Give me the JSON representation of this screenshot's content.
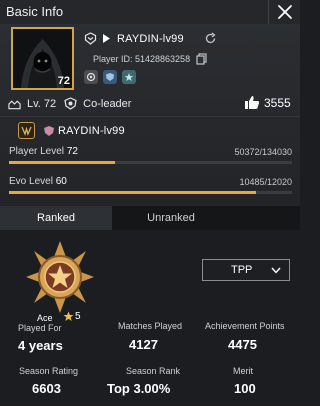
{
  "window": {
    "title": "Basic Info"
  },
  "profile": {
    "avatar_level": "72",
    "player_name": "RAYDIN-lv99",
    "player_id_label": "Player ID: 51428863258",
    "level_label": "Lv. 72",
    "role": "Co-leader",
    "likes": "3555",
    "clan_name": "RAYDIN-lv99"
  },
  "progress": {
    "player_level": {
      "label": "Player Level",
      "value": "72",
      "xp": "50372/134030",
      "fraction": 0.376
    },
    "evo_level": {
      "label": "Evo Level",
      "value": "60",
      "xp": "10485/12020",
      "fraction": 0.872
    }
  },
  "tabs": [
    {
      "label": "Ranked",
      "active": true
    },
    {
      "label": "Unranked",
      "active": false
    }
  ],
  "ranked": {
    "mode_select": "TPP",
    "tier": "Ace",
    "stars": "5",
    "stats": {
      "played_for": {
        "label": "Played For",
        "value": "4 years"
      },
      "matches_played": {
        "label": "Matches Played",
        "value": "4127"
      },
      "achievement_points": {
        "label": "Achievement Points",
        "value": "4475"
      },
      "season_rating": {
        "label": "Season Rating",
        "value": "6603"
      },
      "season_rank": {
        "label": "Season Rank",
        "value": "Top 3.00%"
      },
      "merit": {
        "label": "Merit",
        "value": "100"
      }
    }
  },
  "colors": {
    "accent_gold": "#e8a93a",
    "avatar_border": "#d3a54a",
    "background": "#1b1d20"
  },
  "icons": {
    "close": "close-icon",
    "rank_small": "rank-chevron-icon",
    "refresh": "refresh-icon",
    "copy": "copy-icon",
    "level": "level-icon",
    "role": "co-leader-icon",
    "likes": "thumbs-up-icon",
    "clan": "clan-emblem-icon",
    "tier_badge": "ace-tier-badge-icon",
    "star": "star-icon",
    "dropdown": "chevron-down-icon"
  }
}
